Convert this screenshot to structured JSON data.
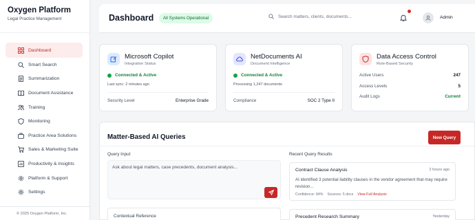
{
  "brand": {
    "title": "Oxygen Platform",
    "subtitle": "Legal Practice Management"
  },
  "sidebar": {
    "items": [
      {
        "label": "Dashboard",
        "icon": "grid-icon",
        "active": true
      },
      {
        "label": "Smart Search",
        "icon": "search-icon"
      },
      {
        "label": "Summarization",
        "icon": "document-icon"
      },
      {
        "label": "Document Assistance",
        "icon": "book-icon"
      },
      {
        "label": "Training",
        "icon": "users-icon"
      },
      {
        "label": "Monitoring",
        "icon": "shield-icon"
      },
      {
        "label": "Practice Area Solutions",
        "icon": "briefcase-icon"
      },
      {
        "label": "Sales & Marketing Suite",
        "icon": "cart-icon"
      },
      {
        "label": "Productivity & Insights",
        "icon": "chart-icon"
      },
      {
        "label": "Platform & Support",
        "icon": "gear-icon"
      },
      {
        "label": "Settings",
        "icon": "settings-icon"
      }
    ],
    "footer": "© 2025 Oxygen Platform, Inc."
  },
  "header": {
    "title": "Dashboard",
    "status": "All Systems Operational",
    "search_placeholder": "Search matters, clients, documents...",
    "user": "Admin"
  },
  "cards": {
    "copilot": {
      "title": "Microsoft Copilot",
      "subtitle": "Integration Status",
      "status": "Connected & Active",
      "note": "Last sync: 2 minutes ago",
      "row_key": "Security Level",
      "row_value": "Enterprise Grade"
    },
    "netdocs": {
      "title": "NetDocuments AI",
      "subtitle": "Document Intelligence",
      "status": "Connected & Active",
      "note": "Processing 1,247 documents",
      "row_key": "Compliance",
      "row_value": "SOC 2 Type II"
    },
    "access": {
      "title": "Data Access Control",
      "subtitle": "Role-Based Security",
      "rows": [
        {
          "key": "Active Users",
          "value": "247"
        },
        {
          "key": "Access Levels",
          "value": "5"
        },
        {
          "key": "Audit Logs",
          "value": "Current"
        }
      ]
    }
  },
  "queries": {
    "title": "Matter-Based AI Queries",
    "new_button": "New Query",
    "input_label": "Query Input",
    "input_placeholder": "Ask about legal matters, case precedents, document analysis...",
    "context_label": "Contextual Reference",
    "results_label": "Recent Query Results",
    "results": [
      {
        "title": "Contract Clause Analysis",
        "time": "2 hours ago",
        "body": "AI identified 3 potential liability clauses in the vendor agreement that may require revision...",
        "confidence": "Confidence: 94%",
        "sources": "Sources: 5 docs",
        "link": "View Full Analysis"
      },
      {
        "title": "Precedent Research Summary",
        "time": "Yesterday"
      }
    ]
  },
  "colors": {
    "accent": "#c62828",
    "success": "#16a34a",
    "badge_bg": "#dcfce7"
  }
}
